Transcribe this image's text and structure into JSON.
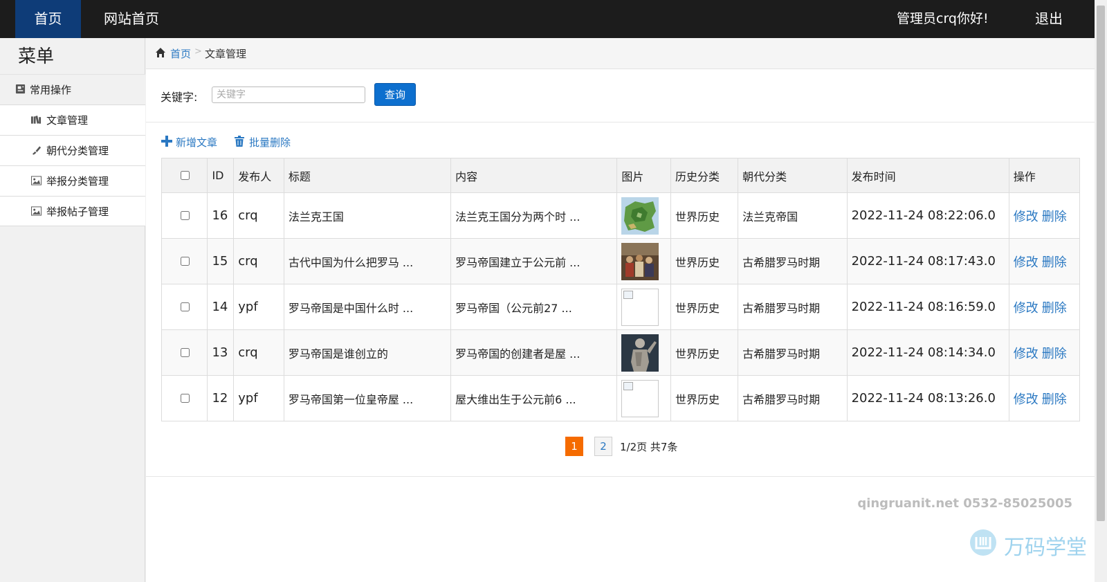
{
  "topbar": {
    "tab_home": "首页",
    "tab_site": "网站首页",
    "greeting": "管理员crq你好!",
    "logout": "退出"
  },
  "sidebar": {
    "title": "菜单",
    "group_label": "常用操作",
    "items": [
      {
        "label": "文章管理",
        "icon": "books-icon"
      },
      {
        "label": "朝代分类管理",
        "icon": "brush-icon"
      },
      {
        "label": "举报分类管理",
        "icon": "picture-icon"
      },
      {
        "label": "举报帖子管理",
        "icon": "picture-icon"
      }
    ]
  },
  "breadcrumb": {
    "home": "首页",
    "separator": ">",
    "current": "文章管理"
  },
  "search": {
    "label": "关键字:",
    "placeholder": "关键字",
    "value": "",
    "button": "查询"
  },
  "actions": {
    "add": "新增文章",
    "batch_delete": "批量删除"
  },
  "table": {
    "headers": [
      "ID",
      "发布人",
      "标题",
      "内容",
      "图片",
      "历史分类",
      "朝代分类",
      "发布时间",
      "操作"
    ],
    "rows": [
      {
        "id": "16",
        "author": "crq",
        "title": "法兰克王国",
        "content": "法兰克王国分为两个时 ...",
        "image": "map",
        "history": "世界历史",
        "dynasty": "法兰克帝国",
        "time": "2022-11-24 08:22:06.0",
        "edit": "修改",
        "delete": "删除"
      },
      {
        "id": "15",
        "author": "crq",
        "title": "古代中国为什么把罗马 ...",
        "content": "罗马帝国建立于公元前 ...",
        "image": "painting",
        "history": "世界历史",
        "dynasty": "古希腊罗马时期",
        "time": "2022-11-24 08:17:43.0",
        "edit": "修改",
        "delete": "删除"
      },
      {
        "id": "14",
        "author": "ypf",
        "title": "罗马帝国是中国什么时 ...",
        "content": "罗马帝国（公元前27 ...",
        "image": "broken",
        "history": "世界历史",
        "dynasty": "古希腊罗马时期",
        "time": "2022-11-24 08:16:59.0",
        "edit": "修改",
        "delete": "删除"
      },
      {
        "id": "13",
        "author": "crq",
        "title": "罗马帝国是谁创立的",
        "content": "罗马帝国的创建者是屋 ...",
        "image": "statue",
        "history": "世界历史",
        "dynasty": "古希腊罗马时期",
        "time": "2022-11-24 08:14:34.0",
        "edit": "修改",
        "delete": "删除"
      },
      {
        "id": "12",
        "author": "ypf",
        "title": "罗马帝国第一位皇帝屋 ...",
        "content": "屋大维出生于公元前6 ...",
        "image": "broken",
        "history": "世界历史",
        "dynasty": "古希腊罗马时期",
        "time": "2022-11-24 08:13:26.0",
        "edit": "修改",
        "delete": "删除"
      }
    ]
  },
  "pagination": {
    "current": "1",
    "next": "2",
    "info": "1/2页 共7条"
  },
  "footer": {
    "contact": "qingruanit.net 0532-85025005",
    "watermark": "万码学堂"
  },
  "colors": {
    "topbar_bg": "#1c1c1c",
    "active_tab": "#0e3c78",
    "link": "#2a78c2",
    "primary_button": "#0d6fce",
    "current_page": "#f56b00"
  }
}
